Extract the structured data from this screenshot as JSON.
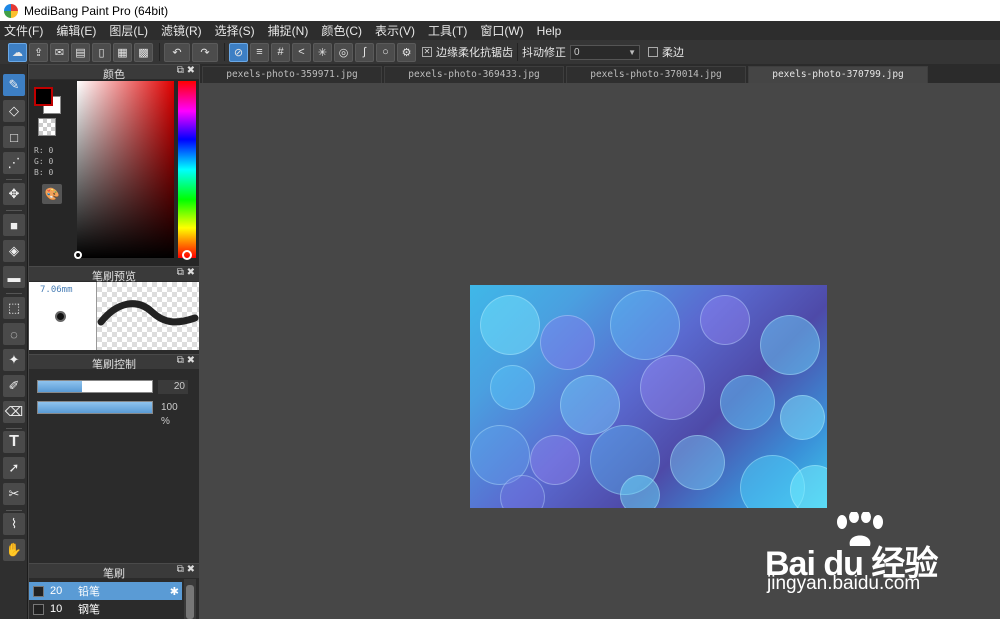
{
  "window": {
    "title": "MediBang Paint Pro (64bit)"
  },
  "menu": [
    "文件(F)",
    "编辑(E)",
    "图层(L)",
    "滤镜(R)",
    "选择(S)",
    "捕捉(N)",
    "颜色(C)",
    "表示(V)",
    "工具(T)",
    "窗口(W)",
    "Help"
  ],
  "toolbar": {
    "antialias_label": "边缘柔化抗锯齿",
    "stabilizer_label": "抖动修正",
    "stabilizer_value": "0",
    "soft_edge_label": "柔边"
  },
  "panels": {
    "color_title": "颜色",
    "rgb": {
      "r": "R: 0",
      "g": "G: 0",
      "b": "B: 0"
    },
    "preview_title": "笔刷预览",
    "preview_size": "7.06mm",
    "control_title": "笔刷控制",
    "size_value": "20",
    "opacity_value": "100 %",
    "size_level": 0.39,
    "opacity_level": 1.0,
    "brush_title": "笔刷",
    "brushes": [
      {
        "size": "20",
        "name": "铅笔"
      },
      {
        "size": "10",
        "name": "钢笔"
      }
    ]
  },
  "tabs": [
    "pexels-photo-359971.jpg",
    "pexels-photo-369433.jpg",
    "pexels-photo-370014.jpg",
    "pexels-photo-370799.jpg"
  ],
  "watermark": {
    "logo": "Bai du 经验",
    "url": "jingyan.baidu.com"
  },
  "colors": {
    "accent": "#3d7fc4",
    "foreground": "#000000",
    "background": "#ffffff"
  },
  "icons": {
    "tools": [
      "brush-icon",
      "eraser-icon",
      "rectangle-icon",
      "dots-brush-icon",
      "move-icon",
      "fill-rect-icon",
      "bucket-icon",
      "gradient-icon",
      "select-rect-icon",
      "select-lasso-icon",
      "magic-wand-icon",
      "select-pen-icon",
      "select-eraser-icon",
      "text-icon",
      "operation-icon",
      "divide-icon",
      "eyedropper-icon",
      "hand-icon"
    ]
  }
}
